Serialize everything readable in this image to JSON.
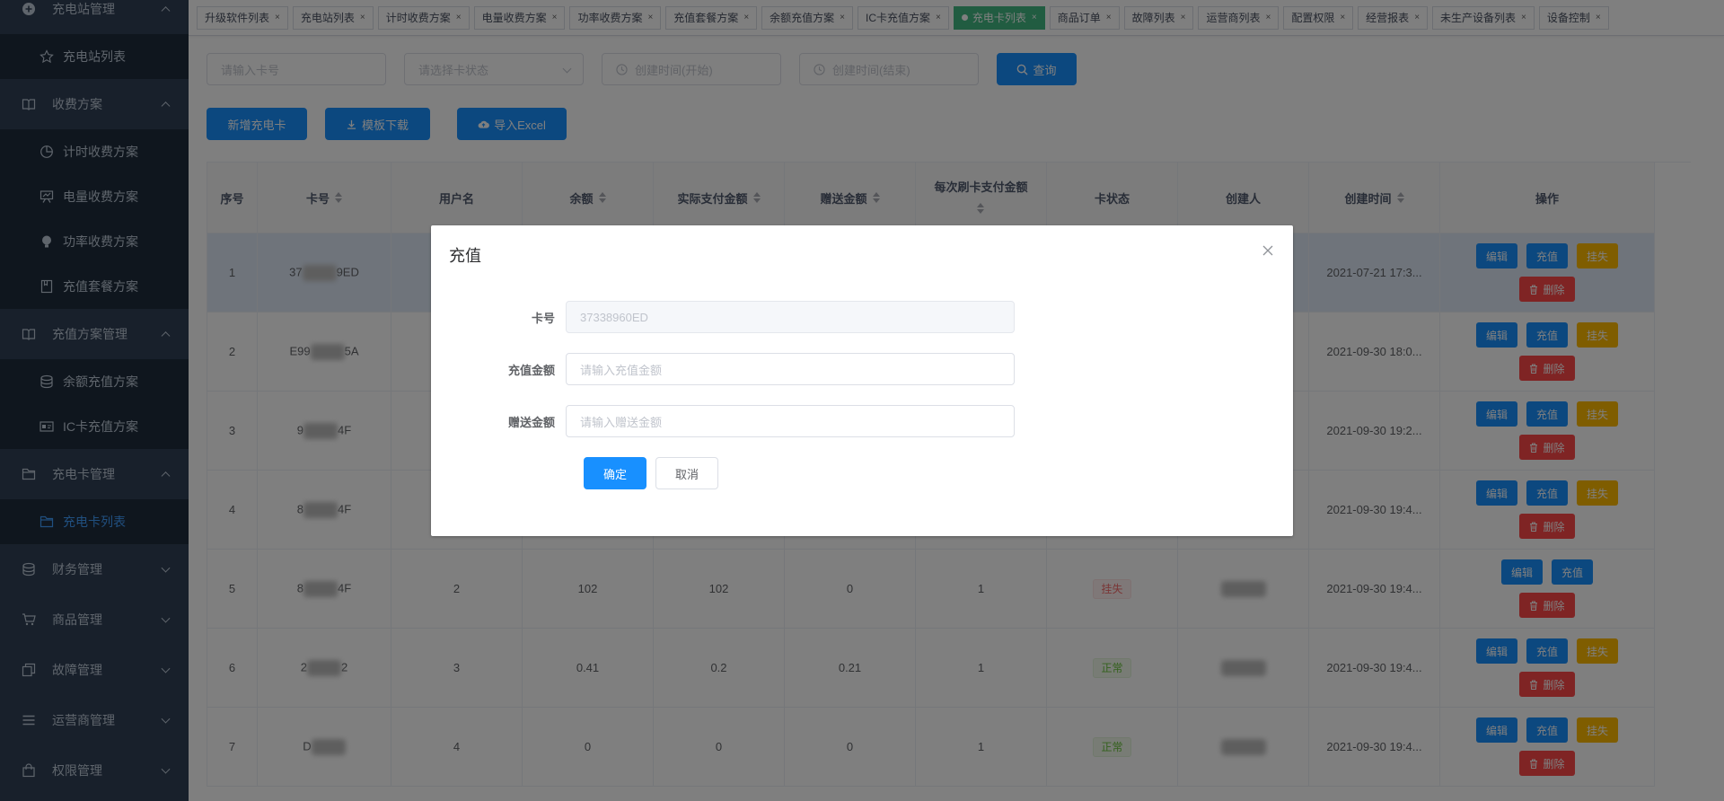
{
  "sidebar": {
    "items": [
      {
        "label": "充电站管理",
        "icon": "plus-circle-icon",
        "type": "menu",
        "expanded": true
      },
      {
        "label": "充电站列表",
        "icon": "star-icon",
        "type": "sub"
      },
      {
        "label": "收费方案",
        "icon": "book-icon",
        "type": "menu",
        "expanded": true
      },
      {
        "label": "计时收费方案",
        "icon": "pie-chart-icon",
        "type": "sub"
      },
      {
        "label": "电量收费方案",
        "icon": "easel-icon",
        "type": "sub"
      },
      {
        "label": "功率收费方案",
        "icon": "bulb-icon",
        "type": "sub"
      },
      {
        "label": "充值套餐方案",
        "icon": "notebook-icon",
        "type": "sub"
      },
      {
        "label": "充值方案管理",
        "icon": "book-icon",
        "type": "menu",
        "expanded": true
      },
      {
        "label": "余额充值方案",
        "icon": "coins-icon",
        "type": "sub"
      },
      {
        "label": "IC卡充值方案",
        "icon": "id-card-icon",
        "type": "sub"
      },
      {
        "label": "充电卡管理",
        "icon": "folder-icon",
        "type": "menu",
        "expanded": true
      },
      {
        "label": "充电卡列表",
        "icon": "folder-icon",
        "type": "sub",
        "active": true
      },
      {
        "label": "财务管理",
        "icon": "coins-icon",
        "type": "menu",
        "expanded": false
      },
      {
        "label": "商品管理",
        "icon": "cart-icon",
        "type": "menu",
        "expanded": false
      },
      {
        "label": "故障管理",
        "icon": "copy-icon",
        "type": "menu",
        "expanded": false
      },
      {
        "label": "运营商管理",
        "icon": "list-icon",
        "type": "menu",
        "expanded": false
      },
      {
        "label": "权限管理",
        "icon": "bag-icon",
        "type": "menu",
        "expanded": false
      }
    ]
  },
  "tags": [
    {
      "label": "升级软件列表"
    },
    {
      "label": "充电站列表"
    },
    {
      "label": "计时收费方案"
    },
    {
      "label": "电量收费方案"
    },
    {
      "label": "功率收费方案"
    },
    {
      "label": "充值套餐方案"
    },
    {
      "label": "余额充值方案"
    },
    {
      "label": "IC卡充值方案"
    },
    {
      "label": "充电卡列表",
      "active": true
    },
    {
      "label": "商品订单"
    },
    {
      "label": "故障列表"
    },
    {
      "label": "运营商列表"
    },
    {
      "label": "配置权限"
    },
    {
      "label": "经营报表"
    },
    {
      "label": "未生产设备列表"
    },
    {
      "label": "设备控制"
    }
  ],
  "filters": {
    "card_placeholder": "请输入卡号",
    "status_placeholder": "请选择卡状态",
    "start_placeholder": "创建时间(开始)",
    "end_placeholder": "创建时间(结束)",
    "query_label": "查询"
  },
  "actions": {
    "add_label": "新增充电卡",
    "template_label": "模板下载",
    "import_label": "导入Excel"
  },
  "table": {
    "headers": [
      {
        "label": "序号",
        "sortable": false
      },
      {
        "label": "卡号",
        "sortable": true
      },
      {
        "label": "用户名",
        "sortable": false
      },
      {
        "label": "余额",
        "sortable": true
      },
      {
        "label": "实际支付金额",
        "sortable": true
      },
      {
        "label": "赠送金额",
        "sortable": true
      },
      {
        "label": "每次刷卡支付金额",
        "sortable": true
      },
      {
        "label": "卡状态",
        "sortable": false
      },
      {
        "label": "创建人",
        "sortable": false
      },
      {
        "label": "创建时间",
        "sortable": true
      },
      {
        "label": "操作",
        "sortable": false
      }
    ],
    "rows": [
      {
        "no": "1",
        "card": "37",
        "card_tail": "9ED",
        "user": "",
        "balance": "",
        "paid": "",
        "gift": "",
        "per_swipe": "",
        "status": "",
        "status_type": "",
        "time": "2021-07-21 17:3...",
        "lost": true,
        "highlight": true
      },
      {
        "no": "2",
        "card": "E99",
        "card_tail": "5A",
        "user": "",
        "balance": "",
        "paid": "",
        "gift": "",
        "per_swipe": "",
        "status": "",
        "status_type": "",
        "time": "2021-09-30 18:0...",
        "lost": true
      },
      {
        "no": "3",
        "card": "9",
        "card_tail": "4F",
        "user": "",
        "balance": "",
        "paid": "",
        "gift": "",
        "per_swipe": "",
        "status": "",
        "status_type": "",
        "time": "2021-09-30 19:2...",
        "lost": true
      },
      {
        "no": "4",
        "card": "8",
        "card_tail": "4F",
        "user": "",
        "balance": "",
        "paid": "",
        "gift": "",
        "per_swipe": "",
        "status": "",
        "status_type": "",
        "time": "2021-09-30 19:4...",
        "lost": true
      },
      {
        "no": "5",
        "card": "8",
        "card_tail": "4F",
        "user": "2",
        "balance": "102",
        "paid": "102",
        "gift": "0",
        "per_swipe": "1",
        "status": "挂失",
        "status_type": "warn",
        "time": "2021-09-30 19:4...",
        "lost": false
      },
      {
        "no": "6",
        "card": "2",
        "card_tail": "2",
        "user": "3",
        "balance": "0.41",
        "paid": "0.2",
        "gift": "0.21",
        "per_swipe": "1",
        "status": "正常",
        "status_type": "ok",
        "time": "2021-09-30 19:4...",
        "lost": true
      },
      {
        "no": "7",
        "card": "D",
        "card_tail": "",
        "user": "4",
        "balance": "0",
        "paid": "0",
        "gift": "0",
        "per_swipe": "1",
        "status": "正常",
        "status_type": "ok",
        "time": "2021-09-30 19:4...",
        "lost": true
      }
    ],
    "op_labels": {
      "edit": "编辑",
      "recharge": "充值",
      "lost": "挂失",
      "delete": "删除"
    }
  },
  "dialog": {
    "title": "充值",
    "card_label": "卡号",
    "card_value": "37338960ED",
    "amount_label": "充值金额",
    "amount_placeholder": "请输入充值金额",
    "gift_label": "赠送金额",
    "gift_placeholder": "请输入赠送金额",
    "confirm_label": "确定",
    "cancel_label": "取消"
  },
  "colors": {
    "sidebar_bg": "#304156",
    "primary": "#1890ff",
    "active_tag": "#42b983",
    "warning": "#ffba00",
    "danger": "#ff4949"
  }
}
